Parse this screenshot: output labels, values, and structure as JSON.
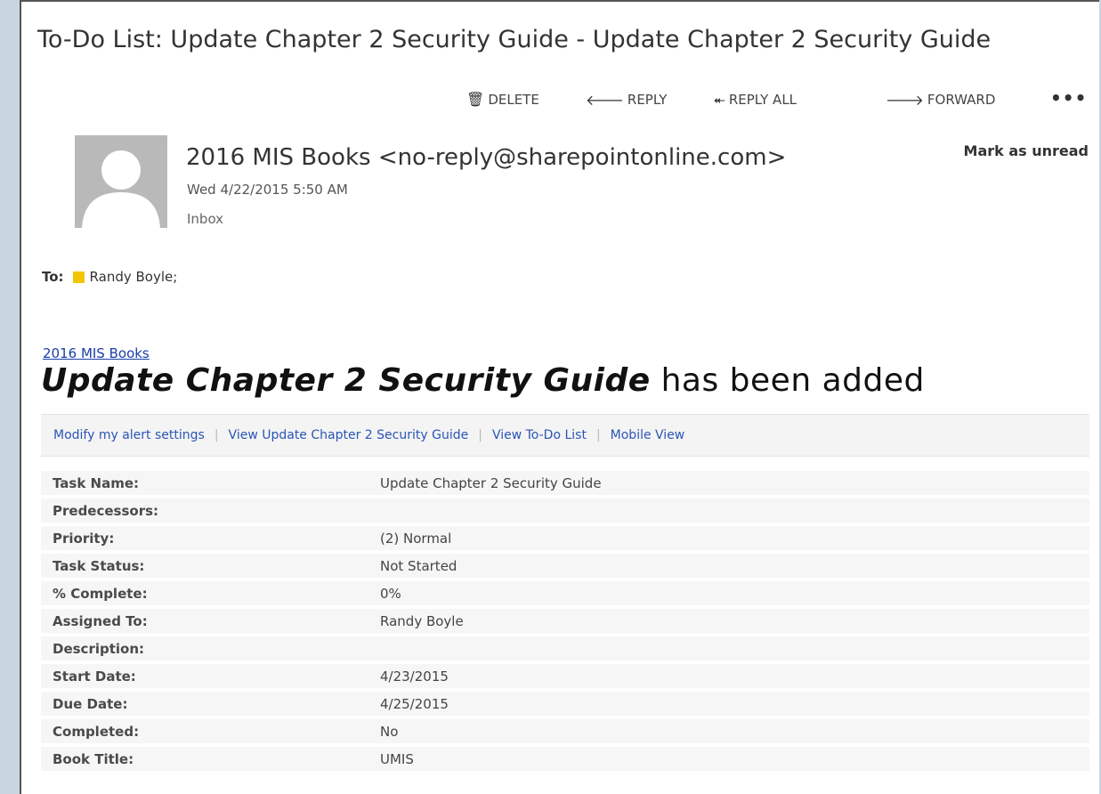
{
  "subject": "To-Do List: Update Chapter 2 Security Guide - Update Chapter 2 Security Guide",
  "toolbar": {
    "delete": "DELETE",
    "reply": "REPLY",
    "reply_all": "REPLY ALL",
    "forward": "FORWARD",
    "more": "•••"
  },
  "header": {
    "sender": "2016 MIS Books <no-reply@sharepointonline.com>",
    "date": "Wed 4/22/2015 5:50 AM",
    "folder": "Inbox",
    "mark_unread": "Mark as unread",
    "to_label": "To:",
    "to_name": "Randy Boyle;"
  },
  "body": {
    "site_link": "2016 MIS Books",
    "headline_bold": "Update Chapter 2 Security Guide",
    "headline_rest": " has been added",
    "links": [
      "Modify my alert settings",
      "View Update Chapter 2 Security Guide",
      "View To-Do List",
      "Mobile View"
    ],
    "fields": [
      {
        "label": "Task Name:",
        "value": "Update Chapter 2 Security Guide"
      },
      {
        "label": "Predecessors:",
        "value": ""
      },
      {
        "label": "Priority:",
        "value": "(2) Normal"
      },
      {
        "label": "Task Status:",
        "value": "Not Started"
      },
      {
        "label": "% Complete:",
        "value": "0%"
      },
      {
        "label": "Assigned To:",
        "value": "Randy Boyle"
      },
      {
        "label": "Description:",
        "value": ""
      },
      {
        "label": "Start Date:",
        "value": "4/23/2015"
      },
      {
        "label": "Due Date:",
        "value": "4/25/2015"
      },
      {
        "label": "Completed:",
        "value": "No"
      },
      {
        "label": "Book Title:",
        "value": "UMIS"
      }
    ]
  },
  "colors": {
    "link": "#2a55b5",
    "presence": "#f3c500"
  }
}
